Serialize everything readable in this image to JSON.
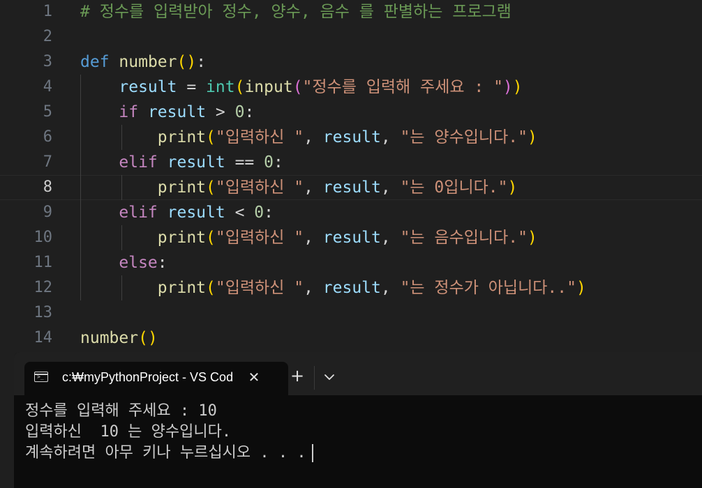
{
  "editor": {
    "line_numbers": [
      "1",
      "2",
      "3",
      "4",
      "5",
      "6",
      "7",
      "8",
      "9",
      "10",
      "11",
      "12",
      "13",
      "14"
    ],
    "active_line": "8",
    "lines": [
      [
        {
          "t": "# 정수를 입력받아 정수, 양수, 음수 를 판별하는 프로그램",
          "c": "comment"
        }
      ],
      [],
      [
        {
          "t": "def",
          "c": "kw"
        },
        {
          "t": " ",
          "c": "op"
        },
        {
          "t": "number",
          "c": "fn"
        },
        {
          "t": "()",
          "c": "p1"
        },
        {
          "t": ":",
          "c": "op"
        }
      ],
      [
        {
          "t": "    ",
          "c": "op"
        },
        {
          "t": "result",
          "c": "var"
        },
        {
          "t": " = ",
          "c": "op"
        },
        {
          "t": "int",
          "c": "builtin"
        },
        {
          "t": "(",
          "c": "p1"
        },
        {
          "t": "input",
          "c": "fn"
        },
        {
          "t": "(",
          "c": "p2"
        },
        {
          "t": "\"정수를 입력해 주세요 : \"",
          "c": "str"
        },
        {
          "t": ")",
          "c": "p2"
        },
        {
          "t": ")",
          "c": "p1"
        }
      ],
      [
        {
          "t": "    ",
          "c": "op"
        },
        {
          "t": "if",
          "c": "ctrl"
        },
        {
          "t": " ",
          "c": "op"
        },
        {
          "t": "result",
          "c": "var"
        },
        {
          "t": " > ",
          "c": "op"
        },
        {
          "t": "0",
          "c": "num"
        },
        {
          "t": ":",
          "c": "op"
        }
      ],
      [
        {
          "t": "        ",
          "c": "op"
        },
        {
          "t": "print",
          "c": "fn"
        },
        {
          "t": "(",
          "c": "p1"
        },
        {
          "t": "\"입력하신 \"",
          "c": "str"
        },
        {
          "t": ", ",
          "c": "op"
        },
        {
          "t": "result",
          "c": "var"
        },
        {
          "t": ", ",
          "c": "op"
        },
        {
          "t": "\"는 양수입니다.\"",
          "c": "str"
        },
        {
          "t": ")",
          "c": "p1"
        }
      ],
      [
        {
          "t": "    ",
          "c": "op"
        },
        {
          "t": "elif",
          "c": "ctrl"
        },
        {
          "t": " ",
          "c": "op"
        },
        {
          "t": "result",
          "c": "var"
        },
        {
          "t": " == ",
          "c": "op"
        },
        {
          "t": "0",
          "c": "num"
        },
        {
          "t": ":",
          "c": "op"
        }
      ],
      [
        {
          "t": "        ",
          "c": "op"
        },
        {
          "t": "print",
          "c": "fn"
        },
        {
          "t": "(",
          "c": "p1"
        },
        {
          "t": "\"입력하신 \"",
          "c": "str"
        },
        {
          "t": ", ",
          "c": "op"
        },
        {
          "t": "result",
          "c": "var"
        },
        {
          "t": ", ",
          "c": "op"
        },
        {
          "t": "\"는 0입니다.\"",
          "c": "str"
        },
        {
          "t": ")",
          "c": "p1"
        }
      ],
      [
        {
          "t": "    ",
          "c": "op"
        },
        {
          "t": "elif",
          "c": "ctrl"
        },
        {
          "t": " ",
          "c": "op"
        },
        {
          "t": "result",
          "c": "var"
        },
        {
          "t": " < ",
          "c": "op"
        },
        {
          "t": "0",
          "c": "num"
        },
        {
          "t": ":",
          "c": "op"
        }
      ],
      [
        {
          "t": "        ",
          "c": "op"
        },
        {
          "t": "print",
          "c": "fn"
        },
        {
          "t": "(",
          "c": "p1"
        },
        {
          "t": "\"입력하신 \"",
          "c": "str"
        },
        {
          "t": ", ",
          "c": "op"
        },
        {
          "t": "result",
          "c": "var"
        },
        {
          "t": ", ",
          "c": "op"
        },
        {
          "t": "\"는 음수입니다.\"",
          "c": "str"
        },
        {
          "t": ")",
          "c": "p1"
        }
      ],
      [
        {
          "t": "    ",
          "c": "op"
        },
        {
          "t": "else",
          "c": "ctrl"
        },
        {
          "t": ":",
          "c": "op"
        }
      ],
      [
        {
          "t": "        ",
          "c": "op"
        },
        {
          "t": "print",
          "c": "fn"
        },
        {
          "t": "(",
          "c": "p1"
        },
        {
          "t": "\"입력하신 \"",
          "c": "str"
        },
        {
          "t": ", ",
          "c": "op"
        },
        {
          "t": "result",
          "c": "var"
        },
        {
          "t": ", ",
          "c": "op"
        },
        {
          "t": "\"는 정수가 아닙니다..\"",
          "c": "str"
        },
        {
          "t": ")",
          "c": "p1"
        }
      ],
      [],
      [
        {
          "t": "number",
          "c": "fn"
        },
        {
          "t": "()",
          "c": "p1"
        }
      ]
    ]
  },
  "terminal": {
    "tab_title": "c:₩myPythonProject - VS Cod",
    "tab_icon": "terminal-icon",
    "close_glyph": "✕",
    "new_tab_glyph": "+",
    "output_lines": [
      "정수를 입력해 주세요 : 10",
      "입력하신  10 는 양수입니다.",
      "계속하려면 아무 키나 누르십시오 . . ."
    ]
  },
  "colors": {
    "editor_bg": "#1f1f1f",
    "terminal_bg": "#0c0c0c",
    "comment": "#6a9955",
    "keyword": "#569cd6",
    "control": "#c586c0",
    "function": "#dcdcaa",
    "string": "#ce9178",
    "variable": "#9cdcfe",
    "number": "#b5cea8",
    "builtin": "#4ec9b0",
    "bracket_1": "#ffd700",
    "bracket_2": "#da70d6"
  }
}
